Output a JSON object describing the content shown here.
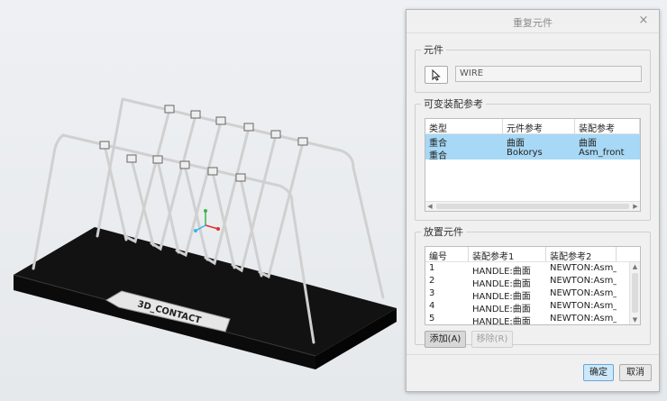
{
  "dialog": {
    "title": "重复元件",
    "close_glyph": "×",
    "component_group": {
      "legend": "元件",
      "value": "WIRE"
    },
    "variable_refs": {
      "legend": "可变装配参考",
      "columns": [
        "类型",
        "元件参考",
        "装配参考"
      ],
      "rows": [
        [
          "重合",
          "曲面",
          "曲面"
        ],
        [
          "重合",
          "Bokorys",
          "Asm_front"
        ]
      ]
    },
    "placement": {
      "legend": "放置元件",
      "columns": [
        "编号",
        "装配参考1",
        "装配参考2"
      ],
      "rows": [
        [
          "1",
          "HANDLE:曲面",
          "NEWTON:Asm_f"
        ],
        [
          "2",
          "HANDLE:曲面",
          "NEWTON:Asm_f"
        ],
        [
          "3",
          "HANDLE:曲面",
          "NEWTON:Asm_f"
        ],
        [
          "4",
          "HANDLE:曲面",
          "NEWTON:Asm_f"
        ],
        [
          "5",
          "HANDLE:曲面",
          "NEWTON:Asm_f"
        ]
      ],
      "add_label": "添加(A)",
      "remove_label": "移除(R)"
    },
    "ok_label": "确定",
    "cancel_label": "取消"
  },
  "model": {
    "base_plate_text": "3D_CONTACT",
    "colors": {
      "base": "#111111",
      "wire": "#d9d9d9",
      "selection": "#a7d8f5",
      "accent": "#5aa9e0"
    }
  }
}
